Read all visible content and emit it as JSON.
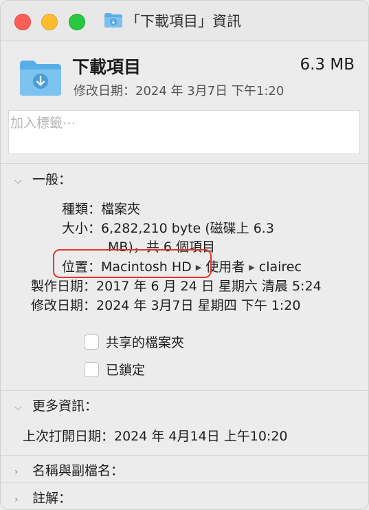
{
  "window": {
    "title": "「下載項目」資訊",
    "traffic_lights": [
      "close",
      "minimize",
      "zoom"
    ]
  },
  "header": {
    "name": "下載項目",
    "size": "6.3 MB",
    "modified": "修改日期：2024 年 3月7日 下午1:20"
  },
  "tags": {
    "placeholder": "加入標籤⋯"
  },
  "general": {
    "heading": "一般：",
    "kind_label": "種類：",
    "kind_value": "檔案夾",
    "size_label": "大小：",
    "size_value_line1": "6,282,210 byte (磁碟上 6.3",
    "size_value_line2": "MB)，共 6 個項目",
    "where_label": "位置：",
    "where_path": [
      "Macintosh HD",
      "使用者",
      "clairec"
    ],
    "created_label": "製作日期：",
    "created_value": "2017 年 6 月 24 日 星期六 清晨 5:24",
    "modified_label": "修改日期：",
    "modified_value": "2024 年 3月7日 星期四 下午 1:20",
    "shared_folder": "共享的檔案夾",
    "locked": "已鎖定"
  },
  "more_info": {
    "heading": "更多資訊：",
    "last_opened": "上次打開日期：2024 年 4月14日 上午10:20"
  },
  "collapsed_sections": {
    "name_extension": "名稱與副檔名：",
    "comments": "註解："
  },
  "colors": {
    "highlight_border": "#e8322e",
    "folder_blue": "#5aaee6"
  }
}
